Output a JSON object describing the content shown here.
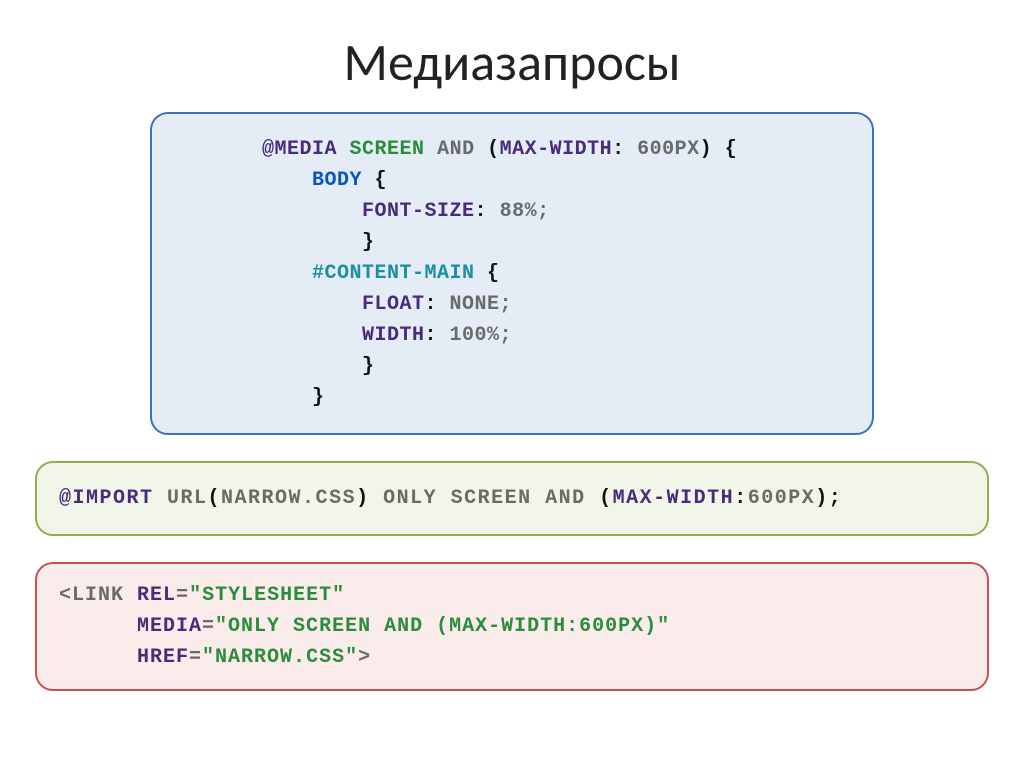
{
  "title": "Медиазапросы",
  "code1": {
    "l1": {
      "at": "@MEDIA",
      "screen": "SCREEN",
      "and": "AND",
      "lparen": "(",
      "prop": "MAX-WIDTH",
      "colon": ":",
      "val": " 600PX",
      "rparen": ")",
      "brace": " {"
    },
    "l2": {
      "sel": "BODY",
      "brace": " {"
    },
    "l3": {
      "prop": "FONT-SIZE",
      "colon": ":",
      "val": " 88%;"
    },
    "l4": {
      "brace": "}"
    },
    "l5": {
      "sel": "#CONTENT-MAIN",
      "brace": " {"
    },
    "l6": {
      "prop": "FLOAT",
      "colon": ":",
      "val": " NONE;"
    },
    "l7": {
      "prop": "WIDTH",
      "colon": ":",
      "val": " 100%;"
    },
    "l8": {
      "brace": "}"
    },
    "l9": {
      "brace": "}"
    }
  },
  "code2": {
    "at": "@IMPORT",
    "url": " URL",
    "lp": "(",
    "file": "NARROW.CSS",
    "rp": ")",
    "only": " ONLY SCREEN AND ",
    "lp2": "(",
    "prop": "MAX-WIDTH",
    "colon": ":",
    "val": "600PX",
    "rp2": ")",
    "semi": ";"
  },
  "code3": {
    "lt": "<",
    "tag": "LINK",
    "sp1": " ",
    "attr1": "REL",
    "eq1": "=",
    "val1": "\"STYLESHEET\"",
    "indent": "      ",
    "attr2": "MEDIA",
    "eq2": "=",
    "val2": "\"ONLY SCREEN AND (MAX-WIDTH:600PX)\"",
    "attr3": "HREF",
    "eq3": "=",
    "val3": "\"NARROW.CSS\"",
    "gt": ">"
  }
}
